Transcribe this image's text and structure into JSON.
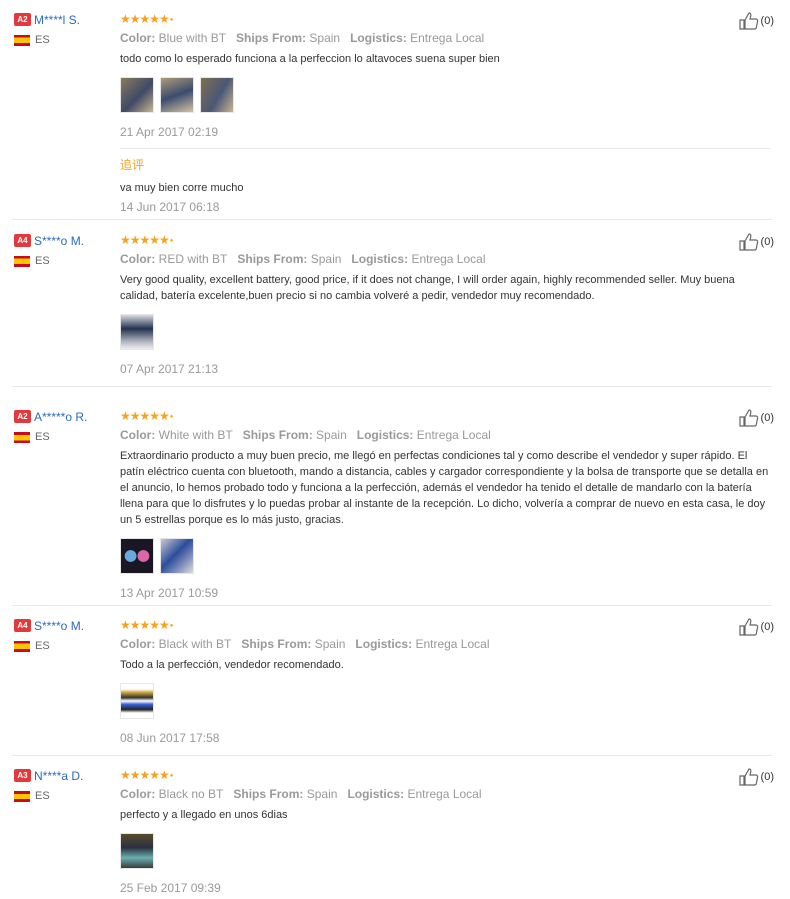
{
  "labels": {
    "color": "Color:",
    "ships_from": "Ships From:",
    "logistics": "Logistics:",
    "followup": "追评"
  },
  "reviews": [
    {
      "level": "A2",
      "user": "M****l S.",
      "country": "ES",
      "rating": 5,
      "likes": "(0)",
      "color": "Blue with BT",
      "ships_from": "Spain",
      "logistics": "Entrega Local",
      "text": "todo como lo esperado funciona a la perfeccion lo altavoces suena super bien",
      "photos": [
        "photo",
        "photo",
        "photo"
      ],
      "date": "21 Apr 2017 02:19",
      "followup_text": "va muy bien corre mucho",
      "followup_date": "14 Jun 2017 06:18"
    },
    {
      "level": "A4",
      "user": "S****o M.",
      "country": "ES",
      "rating": 5,
      "likes": "(0)",
      "color": "RED with BT",
      "ships_from": "Spain",
      "logistics": "Entrega Local",
      "text": "Very good quality, excellent battery, good price, if it does not change, I will order again, highly recommended seller. Muy buena calidad, batería excelente,buen precio si no cambia volveré a pedir, vendedor muy recomendado.",
      "photos": [
        "photo"
      ],
      "date": "07 Apr 2017 21:13"
    },
    {
      "level": "A2",
      "user": "A*****o R.",
      "country": "ES",
      "rating": 5,
      "likes": "(0)",
      "color": "White with BT",
      "ships_from": "Spain",
      "logistics": "Entrega Local",
      "text": "Extraordinario producto a muy buen precio, me llegó en perfectas condiciones tal y como describe el vendedor y super rápido. El patín eléctrico cuenta con bluetooth, mando a distancia, cables y cargador correspondiente y la bolsa de transporte que se detalla en el anuncio, lo hemos probado todo y funciona a la perfección, además el vendedor ha tenido el detalle de mandarlo con la batería llena para que lo disfrutes y lo puedas probar al instante de la recepción. Lo dicho, volvería a comprar de nuevo en esta casa, le doy un 5 estrellas porque es lo más justo, gracias.",
      "photos": [
        "photo",
        "photo"
      ],
      "date": "13 Apr 2017 10:59"
    },
    {
      "level": "A4",
      "user": "S****o M.",
      "country": "ES",
      "rating": 5,
      "likes": "(0)",
      "color": "Black with BT",
      "ships_from": "Spain",
      "logistics": "Entrega Local",
      "text": "Todo a la perfección, vendedor recomendado.",
      "photos": [
        "photo"
      ],
      "date": "08 Jun 2017 17:58"
    },
    {
      "level": "A3",
      "user": "N****a D.",
      "country": "ES",
      "rating": 5,
      "likes": "(0)",
      "color": "Black no BT",
      "ships_from": "Spain",
      "logistics": "Entrega Local",
      "text": "perfecto y a llegado en unos 6dias",
      "photos": [
        "photo"
      ],
      "date": "25 Feb 2017 09:39"
    }
  ],
  "colors": {
    "username": "#2a6bbd",
    "stars": "#f7a11d",
    "level_badge": "#e4393c",
    "muted": "#999999"
  }
}
